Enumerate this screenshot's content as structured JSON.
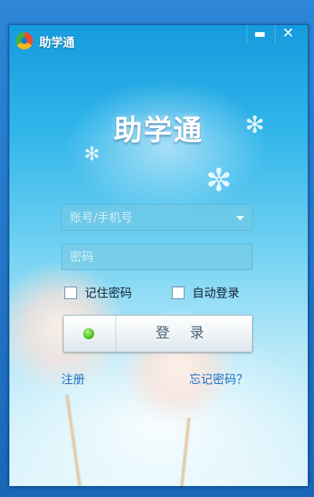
{
  "window": {
    "title": "助学通"
  },
  "brand": {
    "text": "助学通"
  },
  "form": {
    "account_placeholder": "账号/手机号",
    "password_placeholder": "密码",
    "remember_label": "记住密码",
    "autologin_label": "自动登录",
    "login_label": "登 录"
  },
  "links": {
    "register": "注册",
    "forgot": "忘记密码？"
  },
  "colors": {
    "accent": "#1a6fc4",
    "online": "#4fbf1f"
  }
}
